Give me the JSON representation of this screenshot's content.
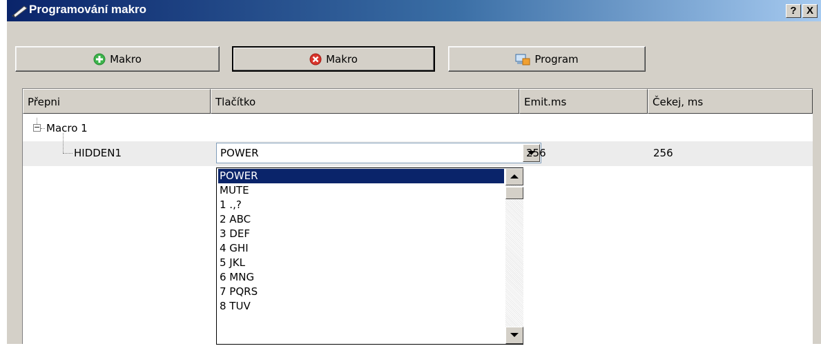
{
  "window": {
    "title": "Programování makro",
    "help_label": "?",
    "close_label": "X"
  },
  "toolbar": {
    "add_label": "Makro",
    "remove_label": "Makro",
    "program_label": "Program"
  },
  "table": {
    "columns": [
      "Přepni",
      "Tlačítko",
      "Emit.ms",
      "Čekej, ms"
    ],
    "group": {
      "label": "Macro 1",
      "expander": "−"
    },
    "row": {
      "switch": "HIDDEN1",
      "button": "POWER",
      "emit": "256",
      "wait": "256"
    }
  },
  "dropdown": {
    "selected": "POWER",
    "options": [
      "POWER",
      "MUTE",
      "1 .,?",
      "2 ABC",
      "3 DEF",
      "4 GHI",
      "5 JKL",
      "6 MNG",
      "7 PQRS",
      "8 TUV"
    ]
  },
  "icons": {
    "title": "pen-icon",
    "add": "plus-circle-icon",
    "remove": "x-circle-icon",
    "program": "program-device-icon"
  },
  "colors": {
    "titlebar_start": "#0a246a",
    "titlebar_end": "#a6caf0",
    "add_green": "#3cb44b",
    "remove_red": "#d9342b",
    "selection": "#0a246a"
  }
}
